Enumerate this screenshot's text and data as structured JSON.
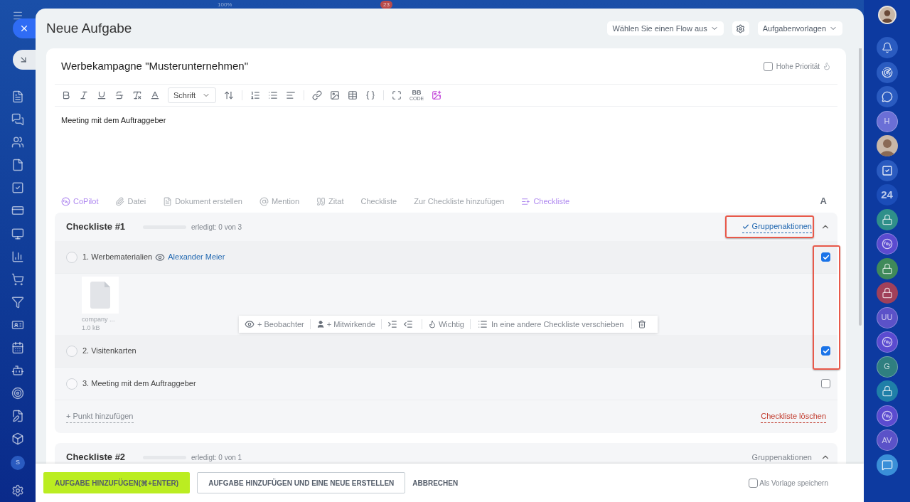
{
  "top_bar": {
    "zoom": "100%",
    "badge": "23"
  },
  "left_rail": {
    "initial": "S"
  },
  "title": "Neue Aufgabe",
  "header_buttons": [
    {
      "kind": "dropdown",
      "label": "Wählen Sie einen Flow aus"
    },
    {
      "kind": "settings"
    },
    {
      "kind": "dropdown",
      "label": "Aufgabenvorlagen"
    }
  ],
  "task": {
    "name": "Werbekampagne \"Musterunternehmen\"",
    "high_priority": {
      "label": "Hohe Priorität",
      "checked": false
    },
    "description": "Meeting mit dem Auftraggeber"
  },
  "editor_toolbar": {
    "font": "Schrift",
    "bbcode": "BB",
    "bbcode_sub": "CODE"
  },
  "actions": [
    {
      "kind": "copilot",
      "label": "CoPilot",
      "accent": true
    },
    {
      "kind": "file",
      "label": "Datei",
      "accent": false
    },
    {
      "kind": "document",
      "label": "Dokument erstellen",
      "accent": false
    },
    {
      "kind": "mention",
      "label": "Mention",
      "accent": false
    },
    {
      "kind": "quote",
      "label": "Zitat",
      "accent": false
    },
    {
      "kind": "text",
      "label": "Checkliste",
      "accent": false
    },
    {
      "kind": "text",
      "label": "Zur Checkliste hinzufügen",
      "accent": false
    },
    {
      "kind": "checklist",
      "label": "Checkliste",
      "accent": true
    }
  ],
  "format_toggle": "A",
  "checklists": [
    {
      "title": "Checkliste #1",
      "level": 0,
      "progress": "erledigt: 0 von 3",
      "expanded": true,
      "group_actions": {
        "label": "Gruppenaktionen",
        "on": true,
        "highlighted": true
      },
      "checkboxes_highlighted": true,
      "items": [
        {
          "text": "1. Werbematerialien",
          "done": false,
          "selected": true,
          "observer": "Alexander Meier",
          "attachment": {
            "name": "company ...",
            "size": "1.0 kB"
          }
        },
        {
          "text": "2. Visitenkarten",
          "done": false,
          "selected": true
        },
        {
          "text": "3. Meeting mit dem Auftraggeber",
          "done": false,
          "selected": false
        }
      ],
      "add_item": "+ Punkt hinzufügen",
      "delete": "Checkliste löschen"
    },
    {
      "title": "Checkliste #2",
      "level": 0,
      "progress": "erledigt: 0 von 1",
      "expanded": true,
      "group_actions": {
        "label": "Gruppenaktionen",
        "on": false
      }
    }
  ],
  "item_toolbar": {
    "observer": "+ Beobachter",
    "participant": "+ Mitwirkende",
    "important": "Wichtig",
    "move": "In eine andere Checkliste verschieben"
  },
  "footer": {
    "primary": "AUFGABE HINZUFÜGEN(⌘+ENTER)",
    "secondary": "AUFGABE HINZUFÜGEN UND EINE NEUE ERSTELLEN",
    "cancel": "ABBRECHEN",
    "save_template": {
      "label": "Als Vorlage speichern",
      "checked": false
    }
  },
  "right_rail": [
    {
      "kind": "bell"
    },
    {
      "kind": "radar"
    },
    {
      "kind": "chat"
    },
    {
      "kind": "letter",
      "text": "H",
      "color": "#6b6fd6"
    },
    {
      "kind": "photo"
    },
    {
      "kind": "tasks"
    },
    {
      "kind": "count",
      "text": "24"
    },
    {
      "kind": "lock",
      "color": "#2f8f8a"
    },
    {
      "kind": "copilot",
      "color": "#5b4bd0"
    },
    {
      "kind": "lock",
      "color": "#3f8a5a"
    },
    {
      "kind": "lock",
      "color": "#a0405a"
    },
    {
      "kind": "letter",
      "text": "UU",
      "color": "#5b52c8"
    },
    {
      "kind": "copilot",
      "color": "#5b4bd0"
    },
    {
      "kind": "letter",
      "text": "G",
      "color": "#2f7f80"
    },
    {
      "kind": "lock",
      "color": "#1f7fa8"
    },
    {
      "kind": "copilot",
      "color": "#5b4bd0"
    },
    {
      "kind": "letter",
      "text": "AV",
      "color": "#5b52c8"
    },
    {
      "kind": "chat-bubble",
      "color": "#3a8fd8"
    }
  ]
}
